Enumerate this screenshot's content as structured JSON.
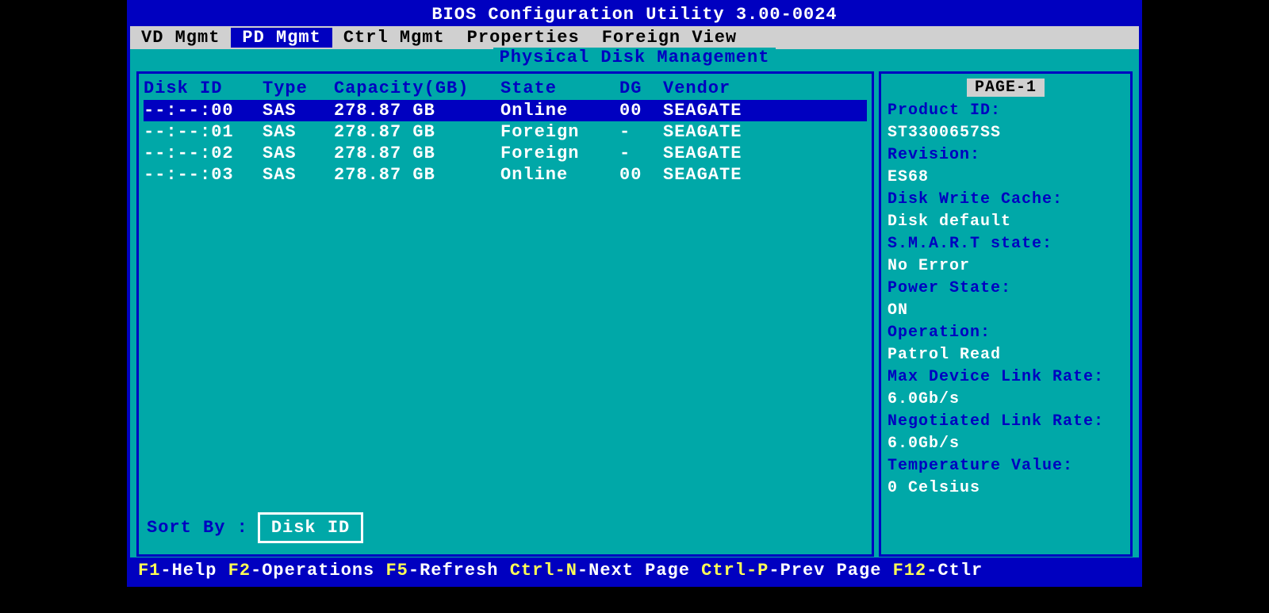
{
  "title": "BIOS Configuration Utility 3.00-0024",
  "menu": {
    "items": [
      "VD Mgmt",
      "PD Mgmt",
      "Ctrl Mgmt",
      "Properties",
      "Foreign View"
    ],
    "active_index": 1
  },
  "panel_title": "Physical Disk Management",
  "table": {
    "headers": {
      "disk_id": "Disk ID",
      "type": "Type",
      "capacity": "Capacity(GB)",
      "state": "State",
      "dg": "DG",
      "vendor": "Vendor"
    },
    "rows": [
      {
        "id": "--:--:00",
        "type": "SAS",
        "capacity": "278.87 GB",
        "state": "Online",
        "dg": "00",
        "vendor": "SEAGATE",
        "selected": true
      },
      {
        "id": "--:--:01",
        "type": "SAS",
        "capacity": "278.87 GB",
        "state": "Foreign",
        "dg": "-",
        "vendor": "SEAGATE",
        "selected": false
      },
      {
        "id": "--:--:02",
        "type": "SAS",
        "capacity": "278.87 GB",
        "state": "Foreign",
        "dg": "-",
        "vendor": "SEAGATE",
        "selected": false
      },
      {
        "id": "--:--:03",
        "type": "SAS",
        "capacity": "278.87 GB",
        "state": "Online",
        "dg": "00",
        "vendor": "SEAGATE",
        "selected": false
      }
    ]
  },
  "sort": {
    "label": "Sort By :",
    "value": "Disk ID"
  },
  "detail": {
    "page": "PAGE-1",
    "product_id_label": "Product ID:",
    "product_id": "ST3300657SS",
    "revision_label": "Revision:",
    "revision": "ES68",
    "write_cache_label": "Disk Write Cache:",
    "write_cache": "Disk default",
    "smart_label": "S.M.A.R.T state:",
    "smart": "No Error",
    "power_label": "Power State:",
    "power": "ON",
    "operation_label": "Operation:",
    "operation": "Patrol Read",
    "max_link_label": "Max Device Link Rate:",
    "max_link": "6.0Gb/s",
    "neg_link_label": "Negotiated Link Rate:",
    "neg_link": "6.0Gb/s",
    "temp_label": "Temperature Value:",
    "temp": "0 Celsius"
  },
  "footer": [
    {
      "key": "F1",
      "text": "-Help "
    },
    {
      "key": "F2",
      "text": "-Operations "
    },
    {
      "key": "F5",
      "text": "-Refresh "
    },
    {
      "key": "Ctrl-N",
      "text": "-Next Page "
    },
    {
      "key": "Ctrl-P",
      "text": "-Prev Page "
    },
    {
      "key": "F12",
      "text": "-Ctlr"
    }
  ]
}
